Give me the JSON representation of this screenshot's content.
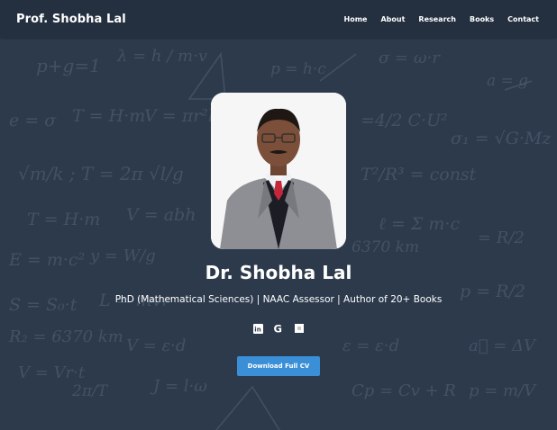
{
  "nav": {
    "brand": "Prof. Shobha Lal",
    "links": [
      "Home",
      "About",
      "Research",
      "Books",
      "Contact"
    ]
  },
  "hero": {
    "name": "Dr. Shobha Lal",
    "subtitle": "PhD (Mathematical Sciences) | NAAC Assessor | Author of 20+ Books",
    "cv_button": "Download Full CV",
    "social_icons": [
      "linkedin-icon",
      "google-scholar-icon",
      "researchgate-icon"
    ]
  },
  "colors": {
    "background": "#2c3a4c",
    "navbar": "#232f3e",
    "button": "#3a8fd6",
    "text": "#ffffff"
  }
}
